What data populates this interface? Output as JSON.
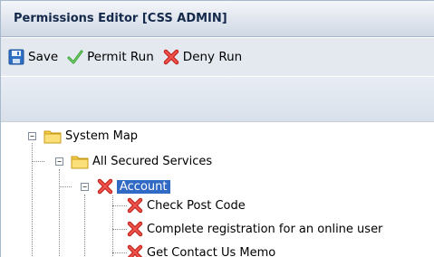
{
  "window": {
    "title": "Permissions Editor [CSS ADMIN]"
  },
  "toolbar": {
    "save_label": "Save",
    "permit_label": "Permit Run",
    "deny_label": "Deny Run"
  },
  "tree": {
    "root": {
      "label": "System Map",
      "expander": "−"
    },
    "group": {
      "label": "All Secured Services",
      "expander": "−"
    },
    "service": {
      "label": "Account",
      "expander": "−"
    },
    "children": [
      {
        "label": "Check Post Code"
      },
      {
        "label": "Complete registration for an online user"
      },
      {
        "label": "Get Contact Us Memo"
      }
    ]
  },
  "colors": {
    "selection": "#316ac5",
    "deny_red": "#e0322b",
    "permit_green": "#3aa33a",
    "folder_yellow": "#f6cf4a"
  },
  "icons": {
    "save": "floppy-disk-icon",
    "permit": "checkmark-icon",
    "deny": "red-x-icon",
    "folder": "folder-icon"
  }
}
